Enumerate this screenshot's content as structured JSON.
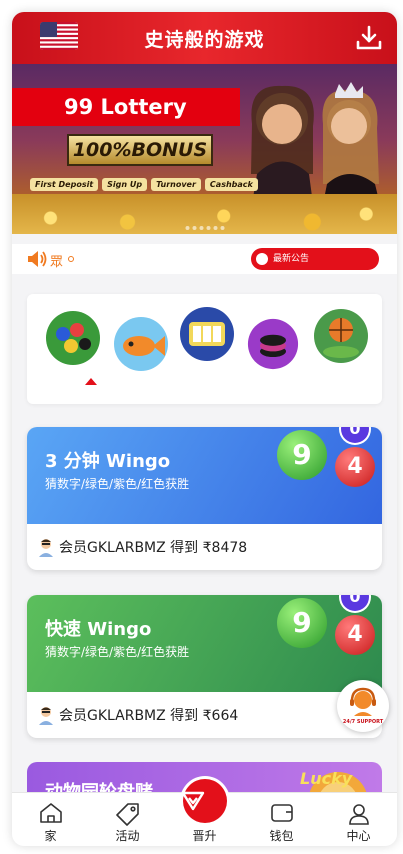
{
  "header": {
    "title": "史诗般的游戏"
  },
  "banner": {
    "headline": "99 Lottery",
    "bonus": "100%BONUS",
    "chips": [
      "First Deposit",
      "Sign Up",
      "Turnover",
      "Cashback"
    ]
  },
  "notice": {
    "marquee": "眾",
    "announce_label": "最新公告"
  },
  "categories": [
    {
      "name": "lottery-category-icon"
    },
    {
      "name": "fishing-category-icon"
    },
    {
      "name": "slots-category-icon"
    },
    {
      "name": "casino-category-icon"
    },
    {
      "name": "sports-category-icon"
    }
  ],
  "cards": [
    {
      "title": "3 分钟 Wingo",
      "subtitle": "猜数字/绿色/紫色/红色获胜",
      "winner": "会员GKLARBMZ 得到 ₹8478",
      "badge": "0",
      "ball_green": "9",
      "ball_red": "4",
      "gradient_from": "#5aa6f5",
      "gradient_to": "#3366e0"
    },
    {
      "title": "快速 Wingo",
      "subtitle": "猜数字/绿色/紫色/红色获胜",
      "winner": "会员GKLARBMZ 得到 ₹664",
      "badge": "0",
      "ball_green": "9",
      "ball_red": "4",
      "gradient_from": "#5cbf5c",
      "gradient_to": "#2e8a4e"
    }
  ],
  "peek_card": {
    "title": "动物园轮盘赌"
  },
  "support": {
    "label": "24/7 SUPPORT"
  },
  "tabbar": {
    "items": [
      {
        "label": "家",
        "icon": "home-icon"
      },
      {
        "label": "活动",
        "icon": "tag-icon"
      },
      {
        "label": "晋升",
        "icon": "promotion-icon"
      },
      {
        "label": "钱包",
        "icon": "wallet-icon"
      },
      {
        "label": "中心",
        "icon": "user-icon"
      }
    ]
  },
  "colors": {
    "brand_red": "#e3101a",
    "badge_purple": "#5a39e0"
  }
}
